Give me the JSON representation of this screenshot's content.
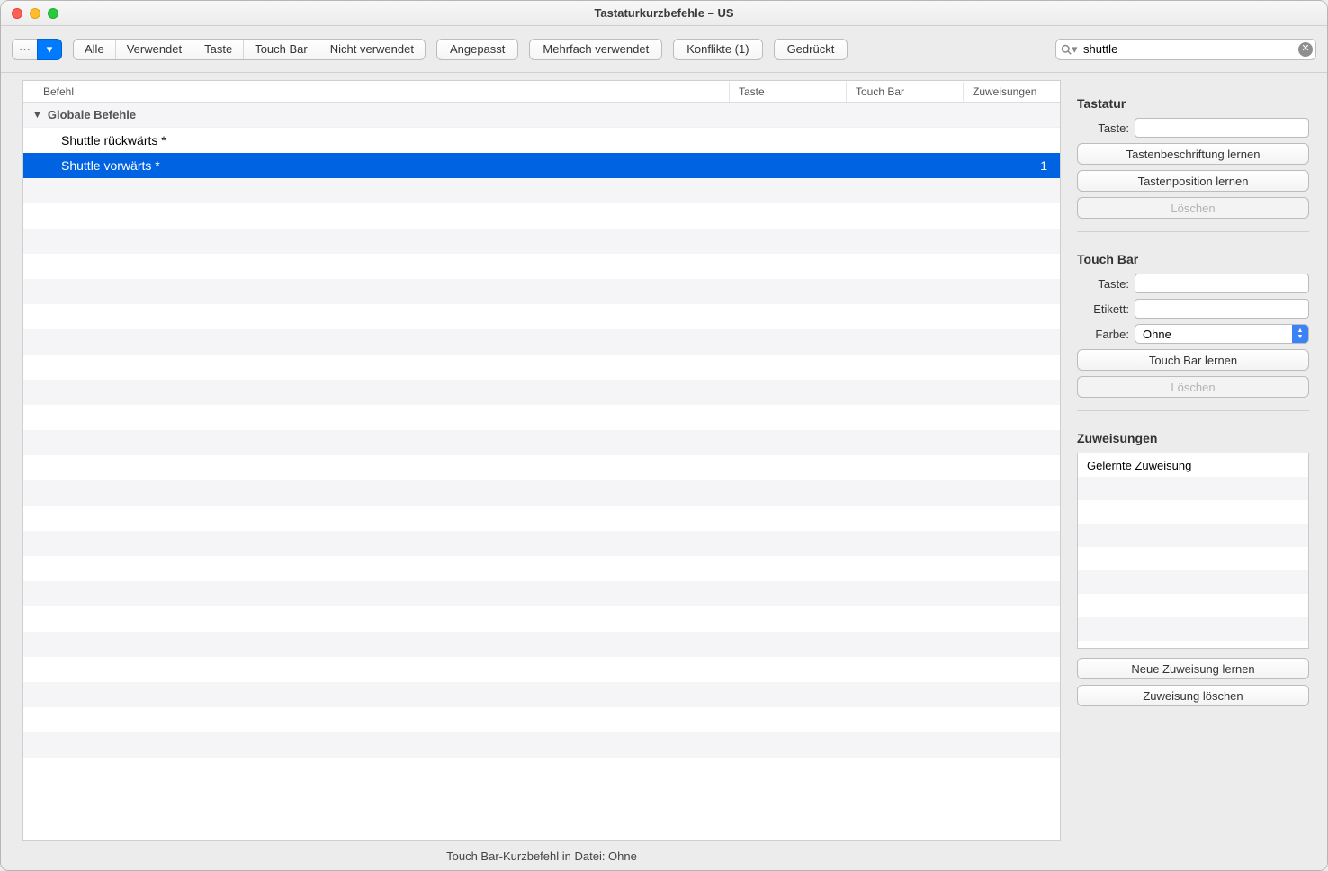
{
  "window": {
    "title": "Tastaturkurzbefehle – US"
  },
  "toolbar": {
    "segments": [
      "Alle",
      "Verwendet",
      "Taste",
      "Touch Bar",
      "Nicht verwendet"
    ],
    "buttons": {
      "angepasst": "Angepasst",
      "mehrfach": "Mehrfach verwendet",
      "konflikte": "Konflikte (1)",
      "gedrueckt": "Gedrückt"
    },
    "search": {
      "value": "shuttle"
    }
  },
  "table": {
    "headers": {
      "befehl": "Befehl",
      "taste": "Taste",
      "touchbar": "Touch Bar",
      "zuweisungen": "Zuweisungen"
    },
    "group": "Globale Befehle",
    "rows": [
      {
        "befehl": "Shuttle rückwärts *",
        "taste": "",
        "touchbar": "",
        "zuw": "",
        "selected": false
      },
      {
        "befehl": "Shuttle vorwärts *",
        "taste": "",
        "touchbar": "",
        "zuw": "1",
        "selected": true
      }
    ]
  },
  "sidebar": {
    "keyboard": {
      "title": "Tastatur",
      "taste_label": "Taste:",
      "taste_value": "",
      "btn_learn_label": "Tastenbeschriftung lernen",
      "btn_learn_pos": "Tastenposition lernen",
      "btn_delete": "Löschen"
    },
    "touchbar": {
      "title": "Touch Bar",
      "taste_label": "Taste:",
      "taste_value": "",
      "etikett_label": "Etikett:",
      "etikett_value": "",
      "farbe_label": "Farbe:",
      "farbe_value": "Ohne",
      "btn_learn": "Touch Bar lernen",
      "btn_delete": "Löschen"
    },
    "assignments": {
      "title": "Zuweisungen",
      "items": [
        "Gelernte Zuweisung"
      ],
      "btn_new": "Neue Zuweisung lernen",
      "btn_delete": "Zuweisung löschen"
    }
  },
  "statusbar": {
    "text": "Touch Bar-Kurzbefehl in Datei: Ohne"
  }
}
